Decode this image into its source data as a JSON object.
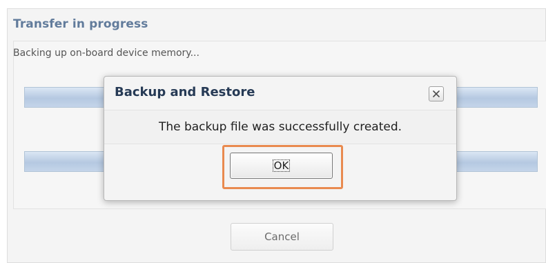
{
  "background_window": {
    "title": "Transfer in progress",
    "status": "Backing up on-board device memory...",
    "cancel_label": "Cancel"
  },
  "dialog": {
    "title": "Backup and Restore",
    "message": "The backup file was successfully created.",
    "ok_label": "OK",
    "close_icon": "close-icon",
    "highlight_color": "#e98a4f"
  },
  "colors": {
    "title_text": "#3f5f86",
    "progress_bar": "#a5bddb"
  }
}
